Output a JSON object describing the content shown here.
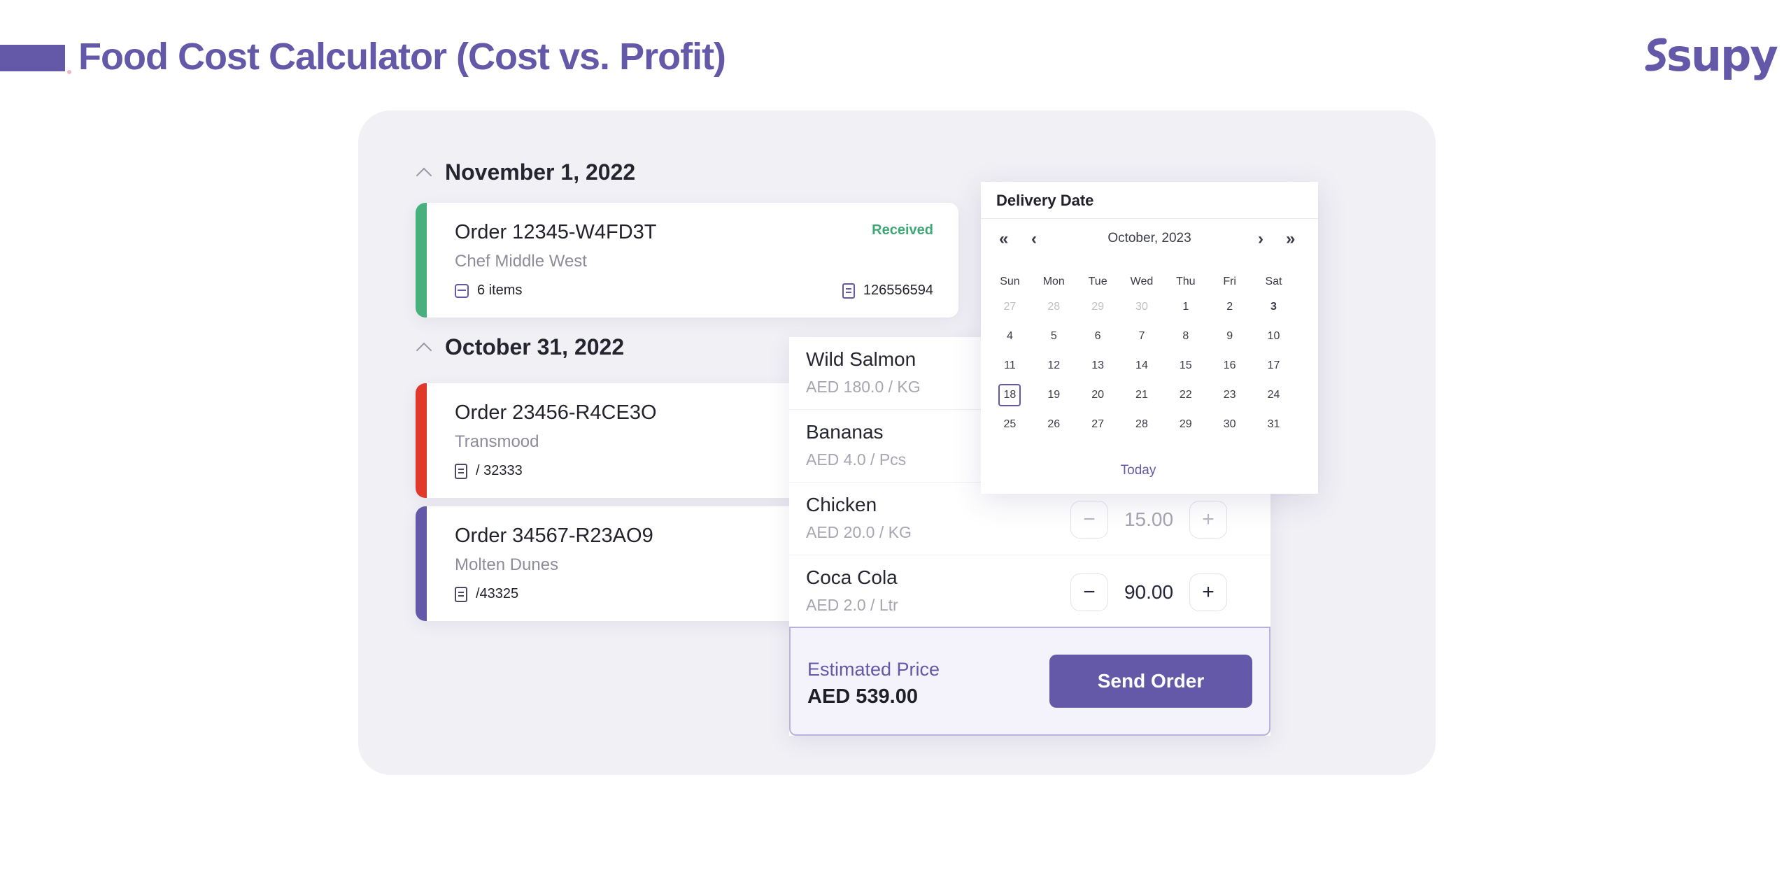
{
  "header": {
    "title": "Food Cost Calculator (Cost vs. Profit)",
    "logo": "supy",
    "accent_color": "#6359a8"
  },
  "sections": [
    {
      "date": "November 1, 2022",
      "orders": [
        {
          "title": "Order 12345-W4FD3T",
          "supplier": "Chef Middle West",
          "items": "6 items",
          "status": "Received",
          "ref": "126556594",
          "stripe_color": "#47b07c"
        }
      ]
    },
    {
      "date": "October 31, 2022",
      "orders": [
        {
          "title": "Order 23456-R4CE3O",
          "supplier": "Transmood",
          "ref": "/ 32333",
          "stripe_color": "#e0392c"
        },
        {
          "title": "Order 34567-R23AO9",
          "supplier": "Molten Dunes",
          "ref": "/43325",
          "stripe_color": "#6359a8"
        }
      ]
    }
  ],
  "products": [
    {
      "name": "Wild Salmon",
      "price": "AED 180.0 / KG"
    },
    {
      "name": "Bananas",
      "price": "AED 4.0 / Pcs"
    },
    {
      "name": "Chicken",
      "price": "AED 20.0 / KG",
      "qty": "15.00"
    },
    {
      "name": "Coca Cola",
      "price": "AED 2.0 / Ltr",
      "qty": "90.00"
    }
  ],
  "stepper": {
    "minus": "−",
    "plus": "+"
  },
  "estimate": {
    "label": "Estimated Price",
    "value": "AED 539.00",
    "button": "Send Order"
  },
  "calendar": {
    "title": "Delivery Date",
    "month": "October, 2023",
    "nav": {
      "first": "«",
      "prev": "‹",
      "next": "›",
      "last": "»"
    },
    "weekdays": [
      "Sun",
      "Mon",
      "Tue",
      "Wed",
      "Thu",
      "Fri",
      "Sat"
    ],
    "weeks": [
      [
        "27",
        "28",
        "29",
        "30",
        "1",
        "2",
        "3"
      ],
      [
        "4",
        "5",
        "6",
        "7",
        "8",
        "9",
        "10"
      ],
      [
        "11",
        "12",
        "13",
        "14",
        "15",
        "16",
        "17"
      ],
      [
        "18",
        "19",
        "20",
        "21",
        "22",
        "23",
        "24"
      ],
      [
        "25",
        "26",
        "27",
        "28",
        "29",
        "30",
        "31"
      ]
    ],
    "selected": "18",
    "today_label": "Today"
  }
}
